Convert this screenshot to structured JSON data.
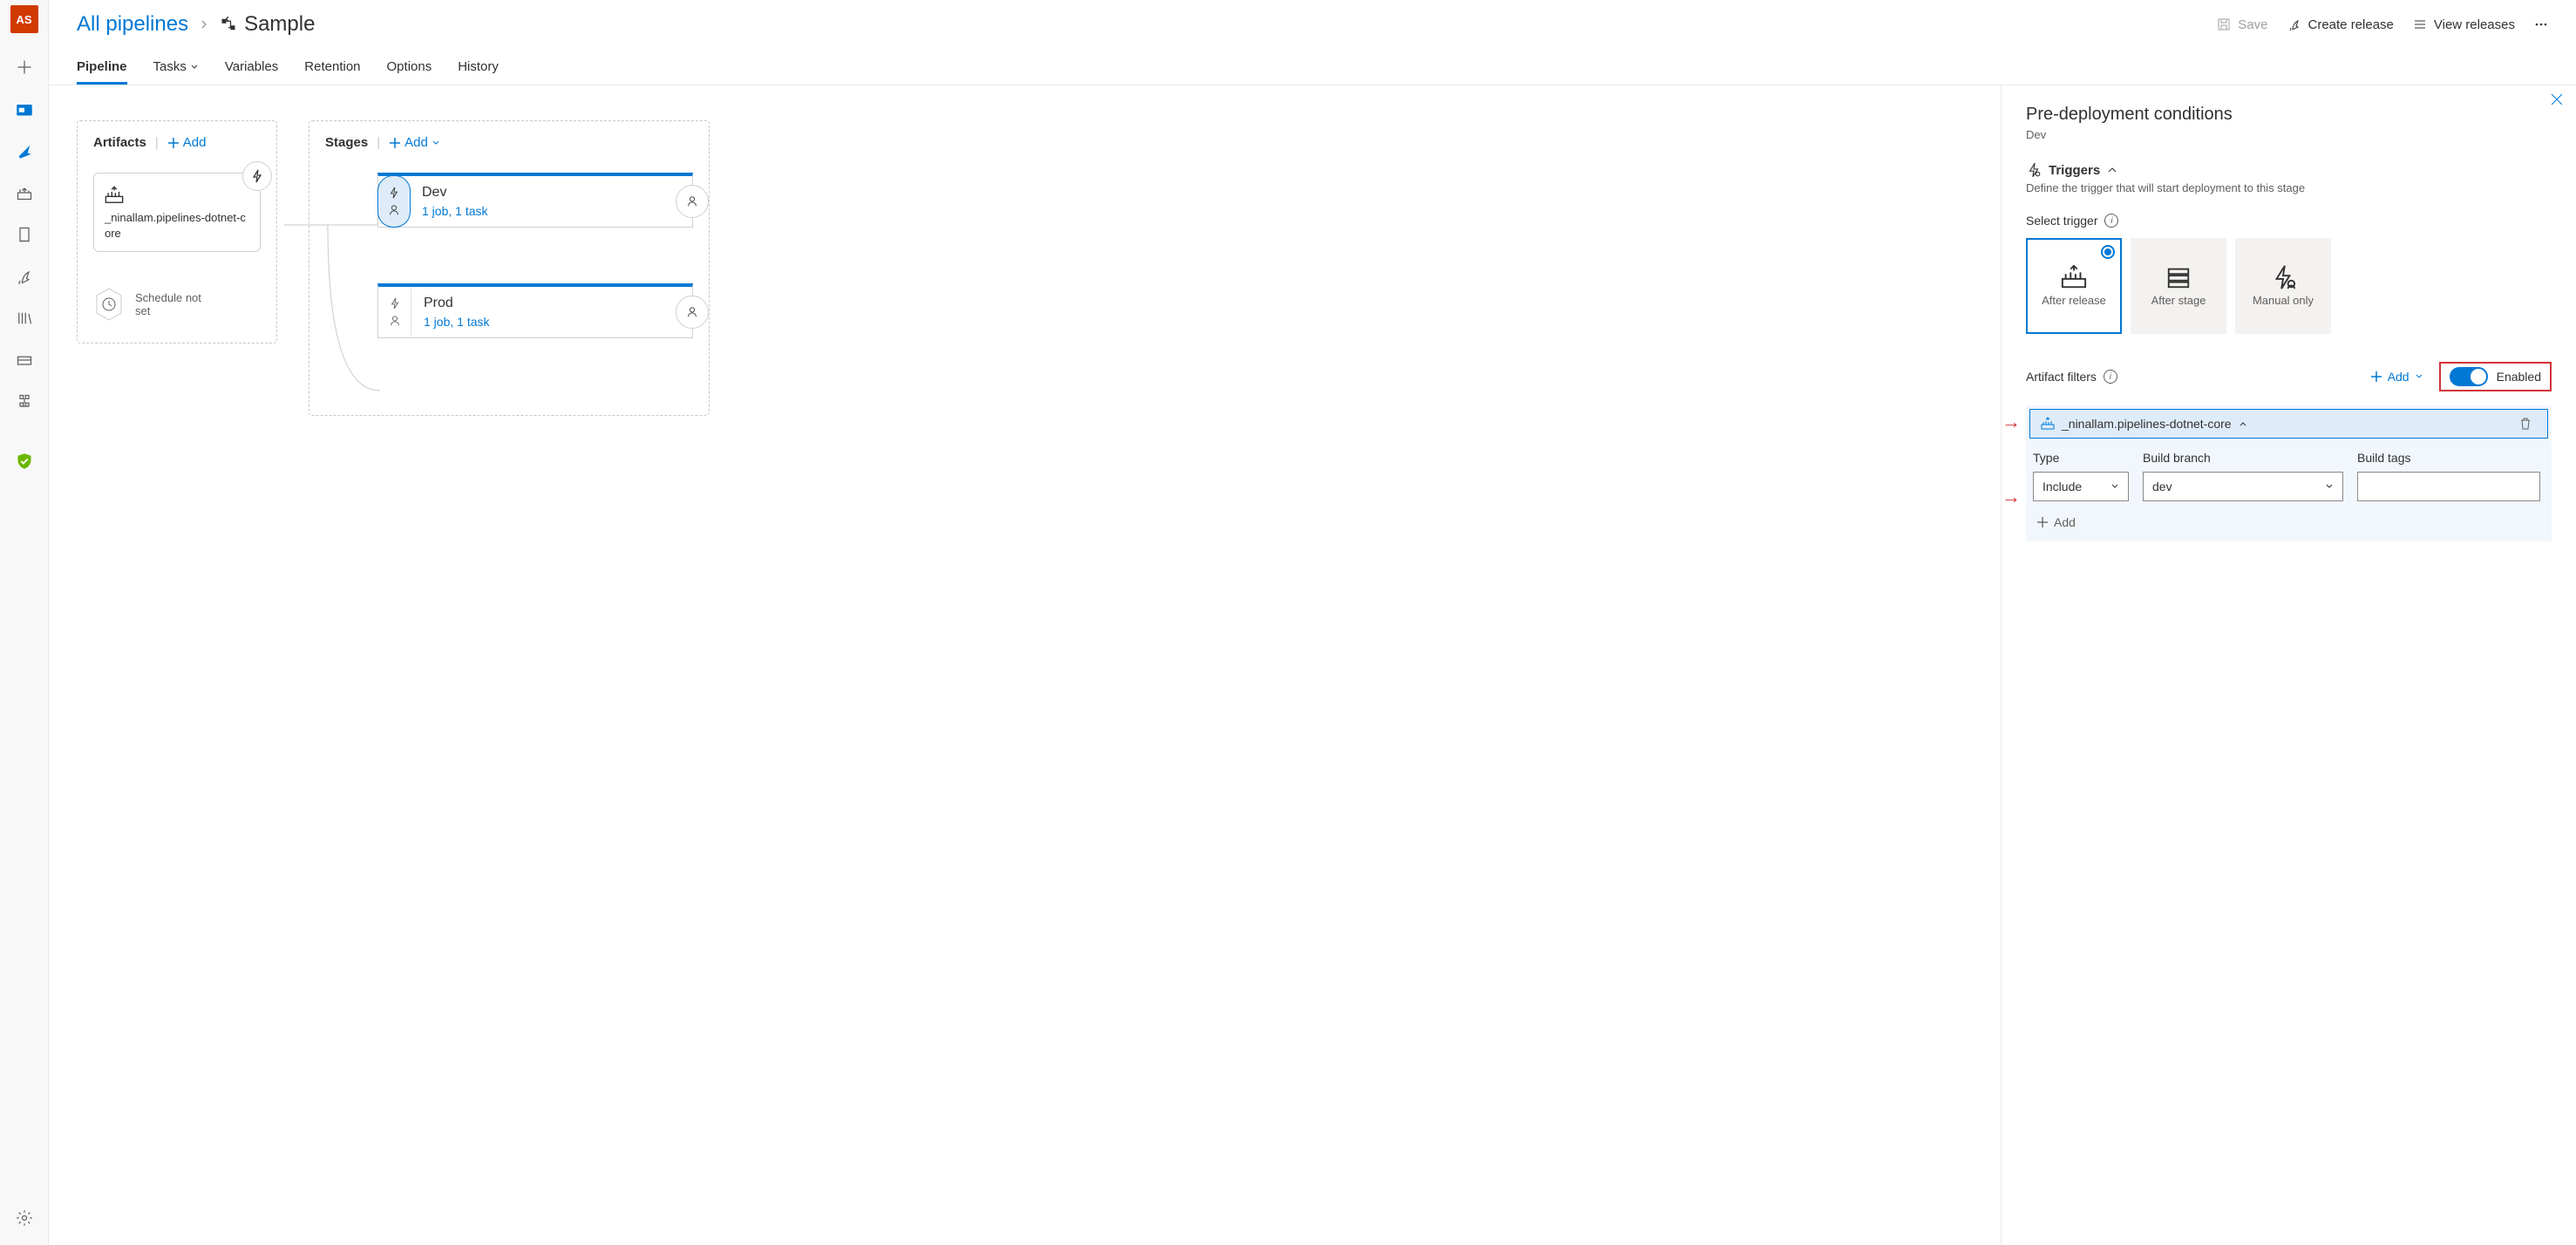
{
  "avatar": "AS",
  "breadcrumb": {
    "root": "All pipelines",
    "title": "Sample"
  },
  "topActions": {
    "save": "Save",
    "create": "Create release",
    "view": "View releases"
  },
  "tabs": [
    "Pipeline",
    "Tasks",
    "Variables",
    "Retention",
    "Options",
    "History"
  ],
  "artifacts": {
    "title": "Artifacts",
    "add": "Add",
    "card_name": "_ninallam.pipelines-dotnet-core",
    "schedule": "Schedule not set"
  },
  "stages": {
    "title": "Stages",
    "add": "Add",
    "list": [
      {
        "name": "Dev",
        "link": "1 job, 1 task"
      },
      {
        "name": "Prod",
        "link": "1 job, 1 task"
      }
    ]
  },
  "side": {
    "title": "Pre-deployment conditions",
    "stage": "Dev",
    "triggers_title": "Triggers",
    "triggers_desc": "Define the trigger that will start deployment to this stage",
    "select_trigger": "Select trigger",
    "trigger_opts": [
      "After release",
      "After stage",
      "Manual only"
    ],
    "artifact_filters": "Artifact filters",
    "add": "Add",
    "enabled": "Enabled",
    "filter_name": "_ninallam.pipelines-dotnet-core",
    "col_type": "Type",
    "col_branch": "Build branch",
    "col_tags": "Build tags",
    "type_val": "Include",
    "branch_val": "dev",
    "add_filter": "Add"
  }
}
